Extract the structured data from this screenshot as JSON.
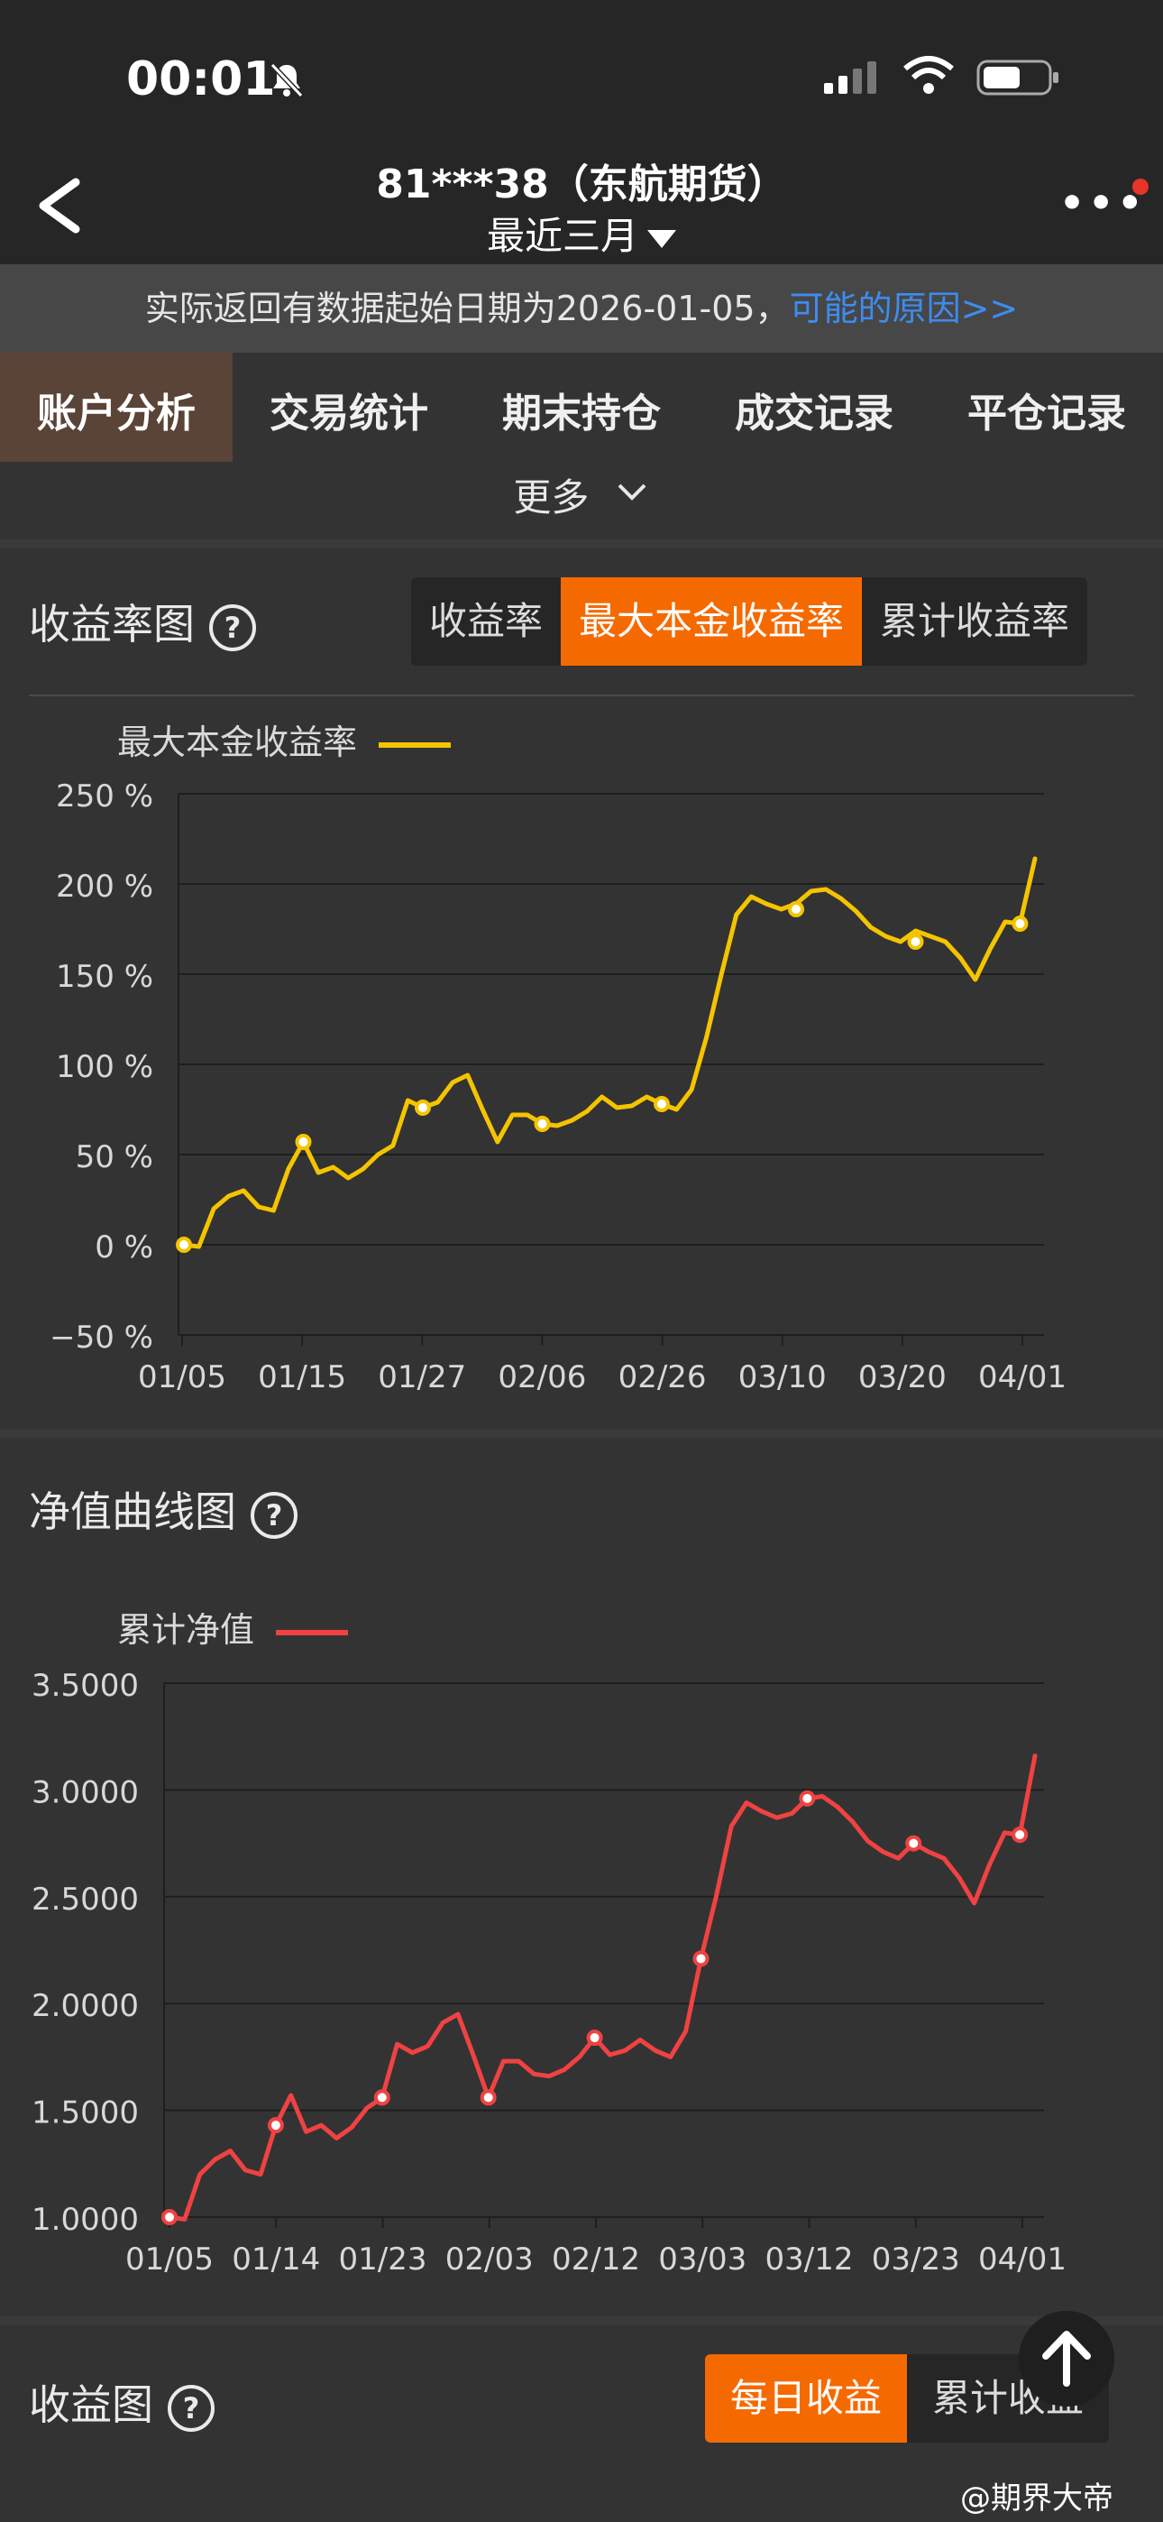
{
  "status_bar": {
    "time": "00:01"
  },
  "header": {
    "title": "81***38（东航期货）",
    "period": "最近三月",
    "more_icon": "ellipsis-icon"
  },
  "notice": {
    "text": "实际返回有数据起始日期为2026-01-05，",
    "link": "可能的原因>>"
  },
  "tabs": [
    "账户分析",
    "交易统计",
    "期末持仓",
    "成交记录",
    "平仓记录"
  ],
  "more_label": "更多",
  "return_chart": {
    "title": "收益率图",
    "segments": [
      "收益率",
      "最大本金收益率",
      "累计收益率"
    ],
    "active_segment": 1,
    "legend": "最大本金收益率",
    "color": "#f5c400"
  },
  "nav_chart": {
    "title": "净值曲线图",
    "legend": "累计净值",
    "color": "#f04242"
  },
  "profit_chart": {
    "title": "收益图",
    "segments": [
      "每日收益",
      "累计收益"
    ],
    "active_segment": 0
  },
  "watermark": "@期界大帝",
  "chart_data": [
    {
      "type": "line",
      "title": "",
      "series": [
        {
          "name": "最大本金收益率",
          "values": [
            0,
            -1,
            20,
            27,
            30,
            21,
            19,
            42,
            57,
            40,
            43,
            37,
            42,
            50,
            55,
            80,
            76,
            79,
            90,
            94,
            75,
            57,
            72,
            72,
            67,
            66,
            69,
            74,
            82,
            76,
            77,
            82,
            78,
            75,
            86,
            115,
            150,
            183,
            193,
            189,
            186,
            189,
            196,
            197,
            192,
            185,
            176,
            171,
            168,
            174,
            171,
            168,
            159,
            147,
            164,
            179,
            178,
            214
          ],
          "markers": [
            [
              0,
              0
            ],
            [
              8,
              57
            ],
            [
              16,
              76
            ],
            [
              24,
              67
            ],
            [
              32,
              78
            ],
            [
              41,
              186
            ],
            [
              49,
              168
            ],
            [
              56,
              178
            ]
          ]
        }
      ],
      "x_ticks": [
        "01/05",
        "01/15",
        "01/27",
        "02/06",
        "02/26",
        "03/10",
        "03/20",
        "04/01"
      ],
      "y_ticks": [
        "250 %",
        "200 %",
        "150 %",
        "100 %",
        "50 %",
        "0 %",
        "−50 %"
      ],
      "ylim": [
        -50,
        250
      ],
      "ylabel": "",
      "xlabel": "",
      "grid": true
    },
    {
      "type": "line",
      "title": "",
      "series": [
        {
          "name": "累计净值",
          "values": [
            1.0,
            0.99,
            1.2,
            1.27,
            1.31,
            1.22,
            1.2,
            1.43,
            1.57,
            1.4,
            1.43,
            1.37,
            1.42,
            1.51,
            1.56,
            1.81,
            1.77,
            1.8,
            1.91,
            1.95,
            1.76,
            1.56,
            1.73,
            1.73,
            1.67,
            1.66,
            1.69,
            1.75,
            1.84,
            1.76,
            1.78,
            1.83,
            1.78,
            1.75,
            1.87,
            2.21,
            2.5,
            2.83,
            2.94,
            2.9,
            2.87,
            2.89,
            2.96,
            2.97,
            2.92,
            2.85,
            2.76,
            2.71,
            2.68,
            2.75,
            2.71,
            2.68,
            2.59,
            2.47,
            2.65,
            2.8,
            2.79,
            3.16
          ],
          "markers": [
            [
              0,
              1.0
            ],
            [
              7,
              1.43
            ],
            [
              14,
              1.56
            ],
            [
              21,
              1.56
            ],
            [
              28,
              1.84
            ],
            [
              35,
              2.21
            ],
            [
              42,
              2.96
            ],
            [
              49,
              2.75
            ],
            [
              56,
              2.79
            ]
          ]
        }
      ],
      "x_ticks": [
        "01/05",
        "01/14",
        "01/23",
        "02/03",
        "02/12",
        "03/03",
        "03/12",
        "03/23",
        "04/01"
      ],
      "y_ticks": [
        "3.5000",
        "3.0000",
        "2.5000",
        "2.0000",
        "1.5000",
        "1.0000"
      ],
      "ylim": [
        1.0,
        3.5
      ],
      "ylabel": "",
      "xlabel": "",
      "grid": true
    }
  ]
}
